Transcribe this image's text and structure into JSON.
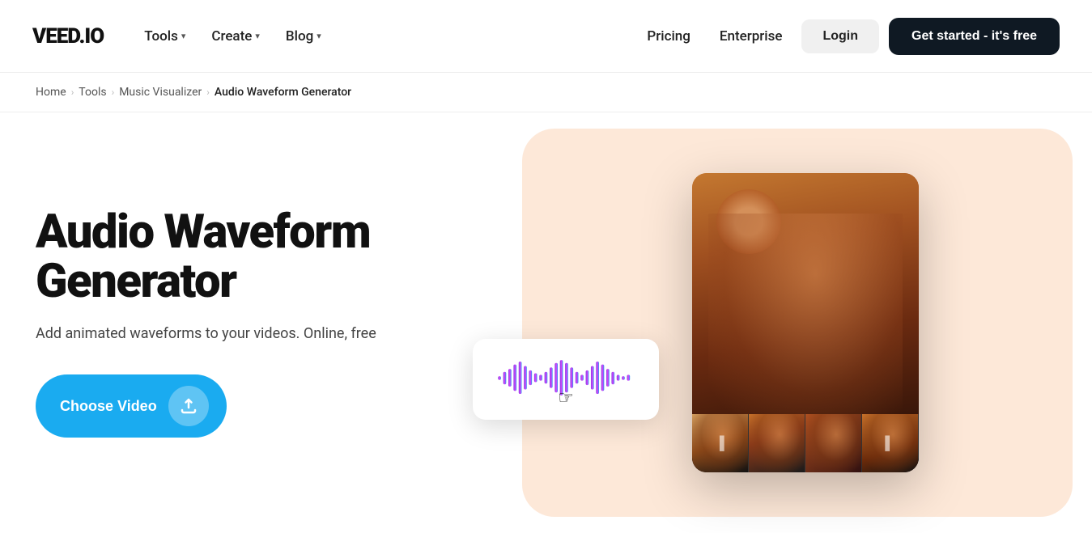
{
  "logo": "VEED.IO",
  "nav": {
    "items": [
      {
        "label": "Tools",
        "hasDropdown": true
      },
      {
        "label": "Create",
        "hasDropdown": true
      },
      {
        "label": "Blog",
        "hasDropdown": true
      }
    ],
    "right": [
      {
        "label": "Pricing",
        "key": "pricing"
      },
      {
        "label": "Enterprise",
        "key": "enterprise"
      }
    ],
    "login_label": "Login",
    "cta_label": "Get started - it's free"
  },
  "breadcrumb": {
    "items": [
      "Home",
      "Tools",
      "Music Visualizer"
    ],
    "current": "Audio Waveform Generator"
  },
  "hero": {
    "title": "Audio Waveform Generator",
    "subtitle": "Add animated waveforms to your videos. Online, free",
    "cta_label": "Choose Video"
  }
}
